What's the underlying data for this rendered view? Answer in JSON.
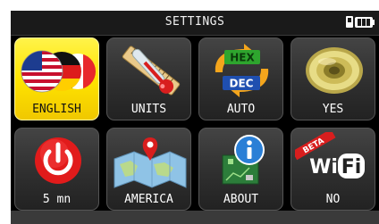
{
  "header": {
    "title": "SETTINGS"
  },
  "tiles": [
    {
      "label": "ENGLISH",
      "icon": "flags-icon",
      "selected": true
    },
    {
      "label": "UNITS",
      "icon": "thermometer-ruler-icon",
      "selected": false
    },
    {
      "label": "AUTO",
      "icon": "hex-dec-icon",
      "selected": false
    },
    {
      "label": "YES",
      "icon": "speaker-icon",
      "selected": false
    },
    {
      "label": "5 mn",
      "icon": "power-icon",
      "selected": false
    },
    {
      "label": "AMERICA",
      "icon": "map-icon",
      "selected": false
    },
    {
      "label": "ABOUT",
      "icon": "info-icon",
      "selected": false
    },
    {
      "label": "NO",
      "icon": "wifi-icon",
      "selected": false,
      "badge": "BETA"
    }
  ],
  "hex_dec_icon": {
    "top": "HEX",
    "bottom": "DEC"
  },
  "wifi_icon": {
    "text_a": "Wi",
    "text_b": "Fi"
  },
  "colors": {
    "selected": "#ffe400",
    "tile": "#333333",
    "screen": "#000000"
  }
}
